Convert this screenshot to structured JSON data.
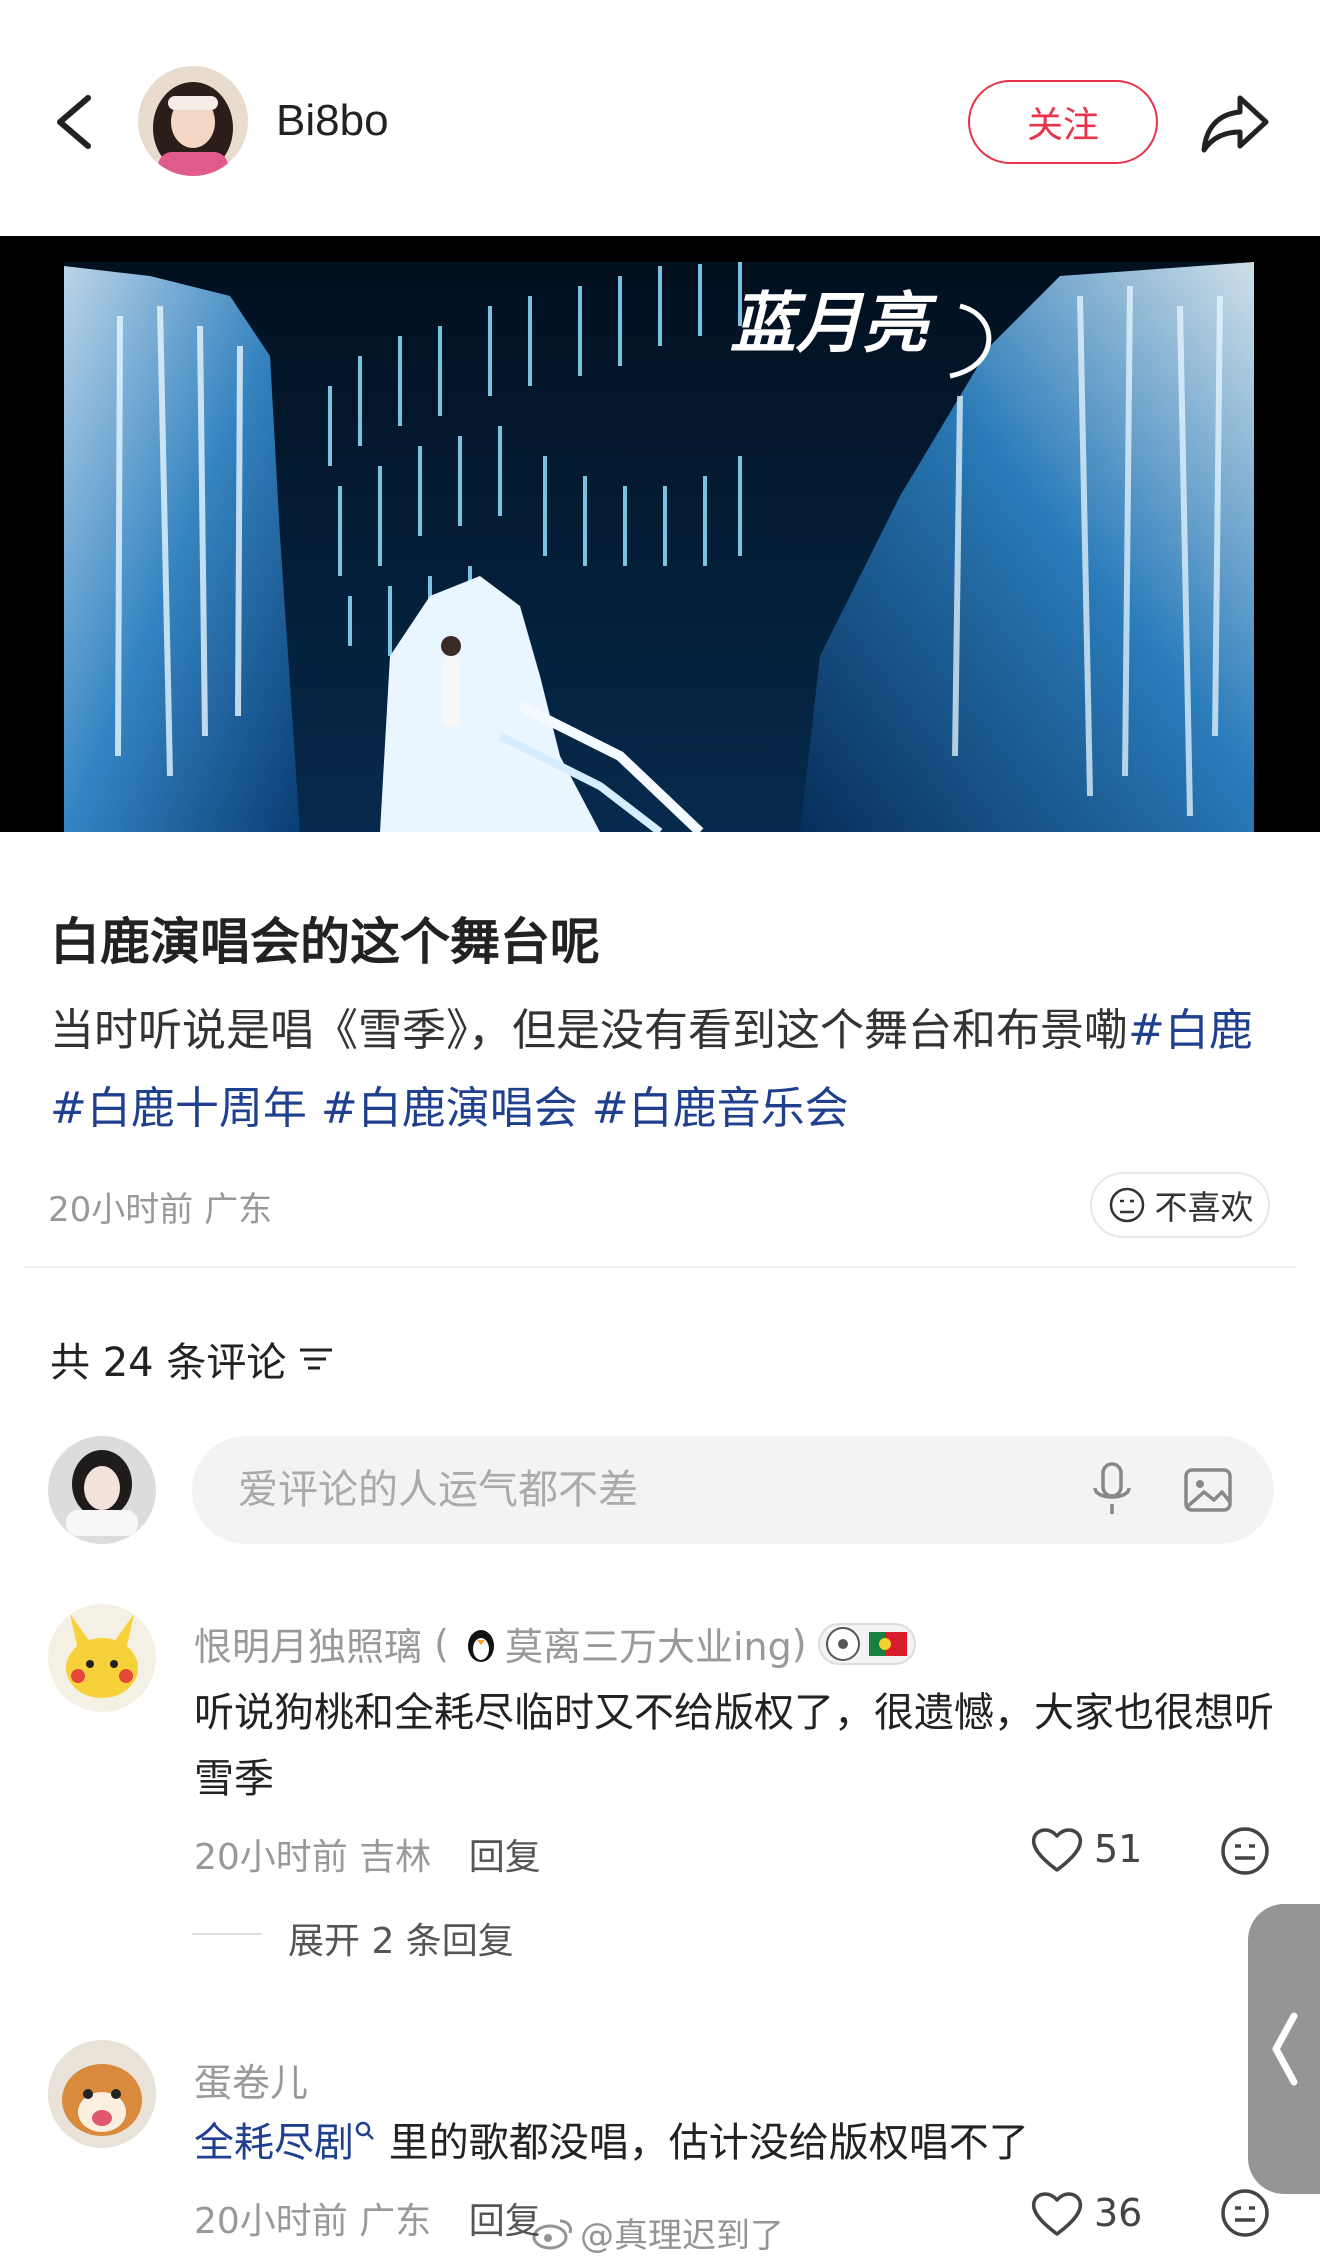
{
  "header": {
    "author_name": "Bi8bo",
    "follow_label": "关注",
    "accent_color": "#e8334a"
  },
  "media": {
    "overlay_logo": "蓝月亮"
  },
  "post": {
    "title": "白鹿演唱会的这个舞台呢",
    "body_text": "当时听说是唱《雪季》，但是没有看到这个舞台和布景嘞",
    "tags": [
      "#白鹿",
      "#白鹿十周年",
      "#白鹿演唱会",
      "#白鹿音乐会"
    ],
    "meta": "20小时前 广东",
    "dislike_label": "不喜欢"
  },
  "comments_section": {
    "count_label": "共 24 条评论",
    "input_placeholder": "爱评论的人运气都不差",
    "icons": [
      "filter-icon",
      "mic-icon",
      "image-icon",
      "heart-icon",
      "emoji-icon"
    ],
    "comments": [
      {
        "name": "恨明月独照璃",
        "name_suffix": "莫离三万大业ing",
        "text": "听说狗桃和全耗尽临时又不给版权了，很遗憾，大家也很想听雪季",
        "meta": "20小时前 吉林",
        "reply_label": "回复",
        "likes": "51",
        "expand_label": "展开 2 条回复"
      },
      {
        "name": "蛋卷儿",
        "link_text": "全耗尽剧",
        "text": " 里的歌都没唱，估计没给版权唱不了",
        "meta": "20小时前 广东",
        "reply_label": "回复",
        "likes": "36"
      }
    ]
  },
  "watermark": "@真理迟到了"
}
